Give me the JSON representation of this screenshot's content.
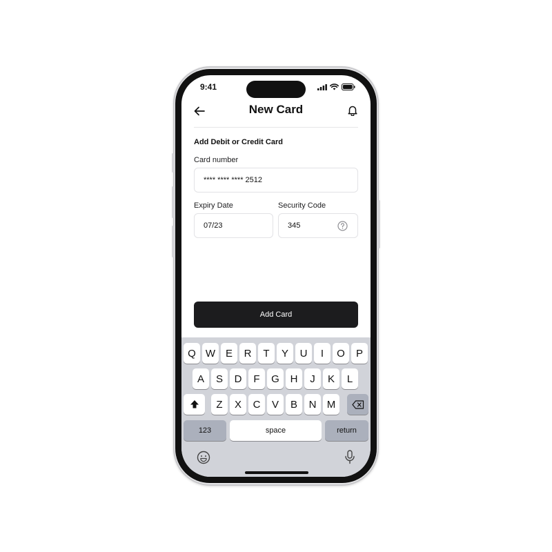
{
  "status_bar": {
    "time": "9:41"
  },
  "header": {
    "title": "New Card"
  },
  "form": {
    "section_title": "Add Debit or Credit Card",
    "card_number": {
      "label": "Card number",
      "value": "**** **** **** 2512"
    },
    "expiry": {
      "label": "Expiry Date",
      "value": "07/23"
    },
    "security": {
      "label": "Security Code",
      "value": "345"
    }
  },
  "actions": {
    "add_card_label": "Add Card"
  },
  "keyboard": {
    "row1": [
      "Q",
      "W",
      "E",
      "R",
      "T",
      "Y",
      "U",
      "I",
      "O",
      "P"
    ],
    "row2": [
      "A",
      "S",
      "D",
      "F",
      "G",
      "H",
      "J",
      "K",
      "L"
    ],
    "row3": [
      "Z",
      "X",
      "C",
      "V",
      "B",
      "N",
      "M"
    ],
    "numbers_label": "123",
    "space_label": "space",
    "return_label": "return"
  },
  "icons": {
    "back": "arrow-left-icon",
    "bell": "bell-icon",
    "help": "question-circle-icon",
    "shift": "shift-icon",
    "backspace": "backspace-icon",
    "emoji": "emoji-icon",
    "mic": "microphone-icon"
  },
  "colors": {
    "primary_button": "#1c1c1e",
    "keyboard_bg": "#d1d3d9",
    "gray_key": "#abb0bc"
  }
}
